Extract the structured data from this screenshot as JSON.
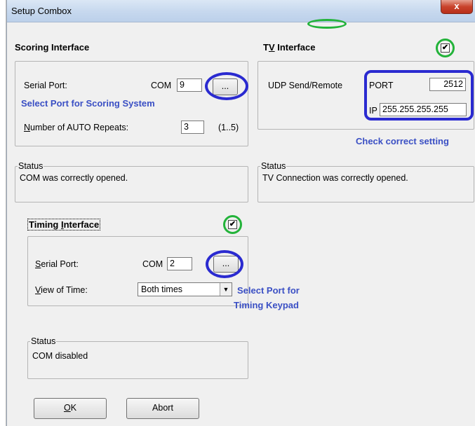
{
  "window": {
    "title": "Setup Combox",
    "close_glyph": "x"
  },
  "scoring": {
    "title": "Scoring Interface",
    "serial_port_label": "Serial Port:",
    "com_label": "COM",
    "com_value": "9",
    "browse_label": "...",
    "annotation": "Select Port for Scoring System",
    "repeats_label": "Number of AUTO Repeats:",
    "repeats_value": "3",
    "repeats_range": "(1..5)",
    "status_legend": "Status",
    "status_text": "COM was correctly opened."
  },
  "tv": {
    "title": "TV Interface",
    "checked": true,
    "udp_label": "UDP Send/Remote",
    "port_label": "PORT",
    "port_value": "2512",
    "ip_label": "IP",
    "ip_value": "255.255.255.255",
    "annotation": "Check correct setting",
    "status_legend": "Status",
    "status_text": "TV Connection was correctly opened."
  },
  "timing": {
    "title": "Timing Interface",
    "checked": true,
    "serial_port_label": "Serial Port:",
    "com_label": "COM",
    "com_value": "2",
    "browse_label": "...",
    "view_label": "View of Time:",
    "view_value": "Both times",
    "annotation_line1": "Select Port for",
    "annotation_line2": "Timing Keypad",
    "status_legend": "Status",
    "status_text": "COM disabled"
  },
  "buttons": {
    "ok": "OK",
    "abort": "Abort"
  },
  "colors": {
    "annotation_blue": "#2a2ad0",
    "annotation_green": "#23b33a",
    "close_red": "#c9432c"
  }
}
